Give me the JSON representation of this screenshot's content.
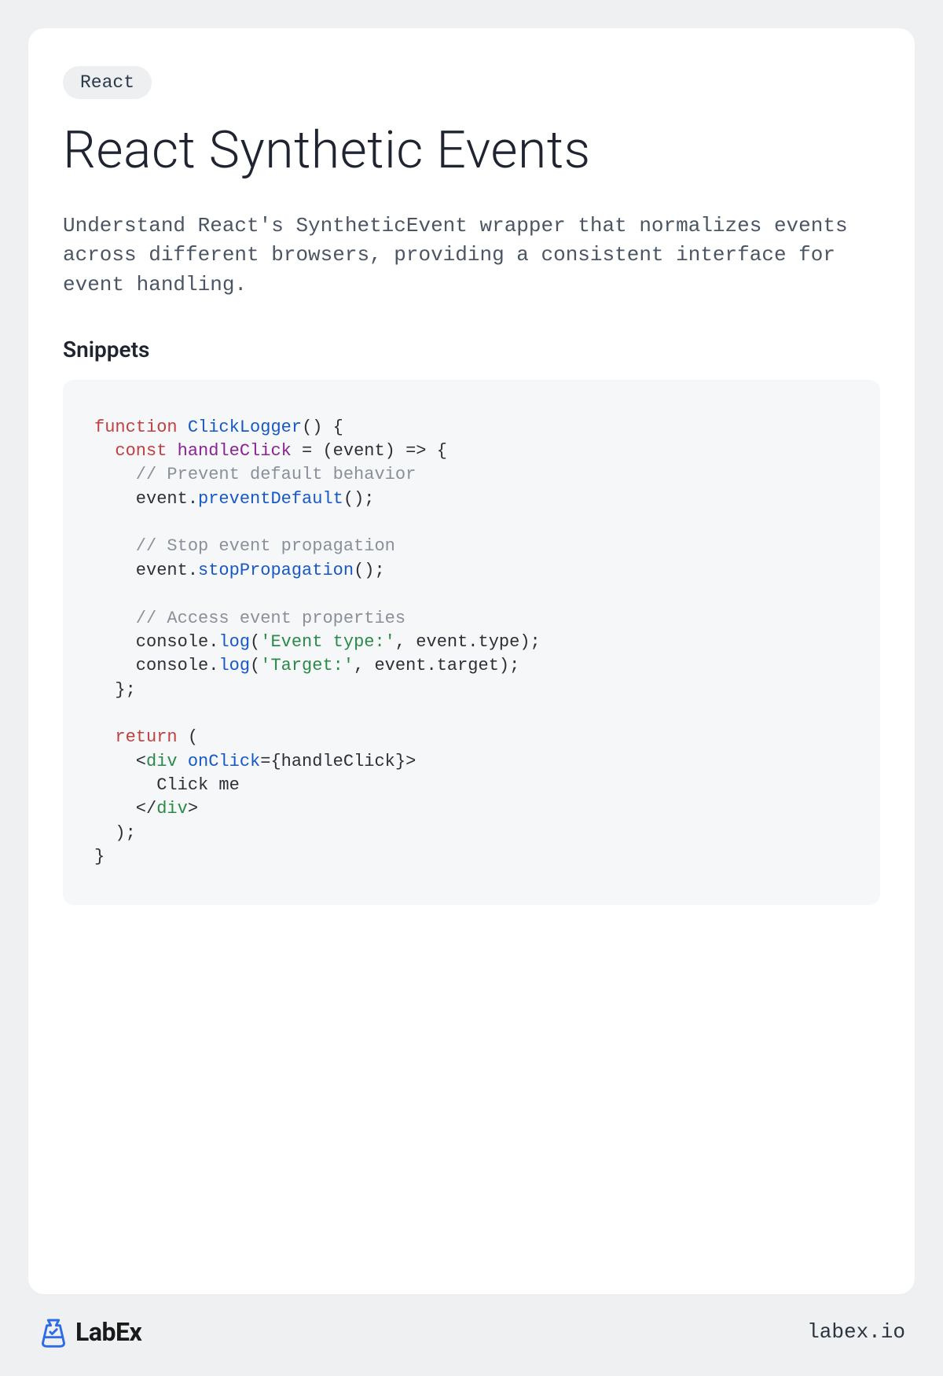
{
  "tag": "React",
  "title": "React Synthetic Events",
  "description": "Understand React's SyntheticEvent wrapper that normalizes events across different browsers, providing a consistent interface for event handling.",
  "section_label": "Snippets",
  "code": {
    "t1": "function",
    "t2": " ",
    "t3": "ClickLogger",
    "t4": "() {",
    "t5": "  ",
    "t6": "const",
    "t7": " ",
    "t8": "handleClick",
    "t9": " = (event) => {",
    "c1": "    // Prevent default behavior",
    "l3a": "    event.",
    "l3b": "preventDefault",
    "l3c": "();",
    "c2": "    // Stop event propagation",
    "l5a": "    event.",
    "l5b": "stopPropagation",
    "l5c": "();",
    "c3": "    // Access event properties",
    "l7a": "    console.",
    "l7b": "log",
    "l7c": "(",
    "l7d": "'Event type:'",
    "l7e": ", event.type);",
    "l8a": "    console.",
    "l8b": "log",
    "l8c": "(",
    "l8d": "'Target:'",
    "l8e": ", event.target);",
    "l9": "  };",
    "r1": "  ",
    "r2": "return",
    "r3": " (",
    "r4a": "    <",
    "r4b": "div",
    "r4c": " ",
    "r4d": "onClick",
    "r4e": "={handleClick}>",
    "r5": "      Click me",
    "r6a": "    </",
    "r6b": "div",
    "r6c": ">",
    "r7": "  );",
    "r8": "}"
  },
  "footer": {
    "brand": "LabEx",
    "site": "labex.io"
  }
}
